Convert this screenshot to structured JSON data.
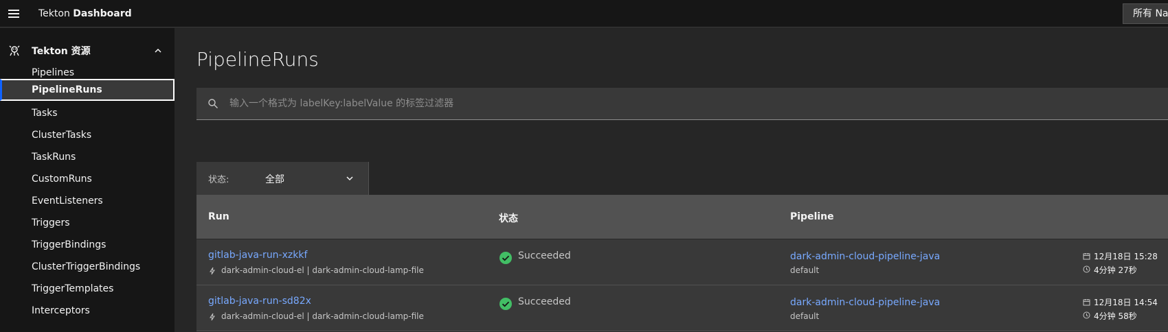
{
  "header": {
    "brand_light": "Tekton ",
    "brand_bold": "Dashboard",
    "namespace_select": "所有 Na"
  },
  "sidebar": {
    "section_title": "Tekton 资源",
    "items": [
      {
        "label": "Pipelines"
      },
      {
        "label": "PipelineRuns"
      },
      {
        "label": "Tasks"
      },
      {
        "label": "ClusterTasks"
      },
      {
        "label": "TaskRuns"
      },
      {
        "label": "CustomRuns"
      },
      {
        "label": "EventListeners"
      },
      {
        "label": "Triggers"
      },
      {
        "label": "TriggerBindings"
      },
      {
        "label": "ClusterTriggerBindings"
      },
      {
        "label": "TriggerTemplates"
      },
      {
        "label": "Interceptors"
      }
    ],
    "active_index": 1
  },
  "main": {
    "title": "PipelineRuns",
    "search": {
      "placeholder": "输入一个格式为 labelKey:labelValue 的标签过滤器",
      "value": ""
    },
    "status_filter": {
      "label": "状态:",
      "value": "全部"
    },
    "table": {
      "headers": [
        "Run",
        "状态",
        "Pipeline"
      ],
      "rows": [
        {
          "run": "gitlab-java-run-xzkkf",
          "trigger": "dark-admin-cloud-el | dark-admin-cloud-lamp-file",
          "status": "Succeeded",
          "pipeline": "dark-admin-cloud-pipeline-java",
          "namespace": "default",
          "date": "12月18日 15:28",
          "duration": "4分钟 27秒"
        },
        {
          "run": "gitlab-java-run-sd82x",
          "trigger": "dark-admin-cloud-el | dark-admin-cloud-lamp-file",
          "status": "Succeeded",
          "pipeline": "dark-admin-cloud-pipeline-java",
          "namespace": "default",
          "date": "12月18日 14:54",
          "duration": "4分钟 58秒"
        }
      ]
    }
  },
  "colors": {
    "accent": "#0f62fe",
    "link": "#78a9ff",
    "success": "#42be65"
  }
}
